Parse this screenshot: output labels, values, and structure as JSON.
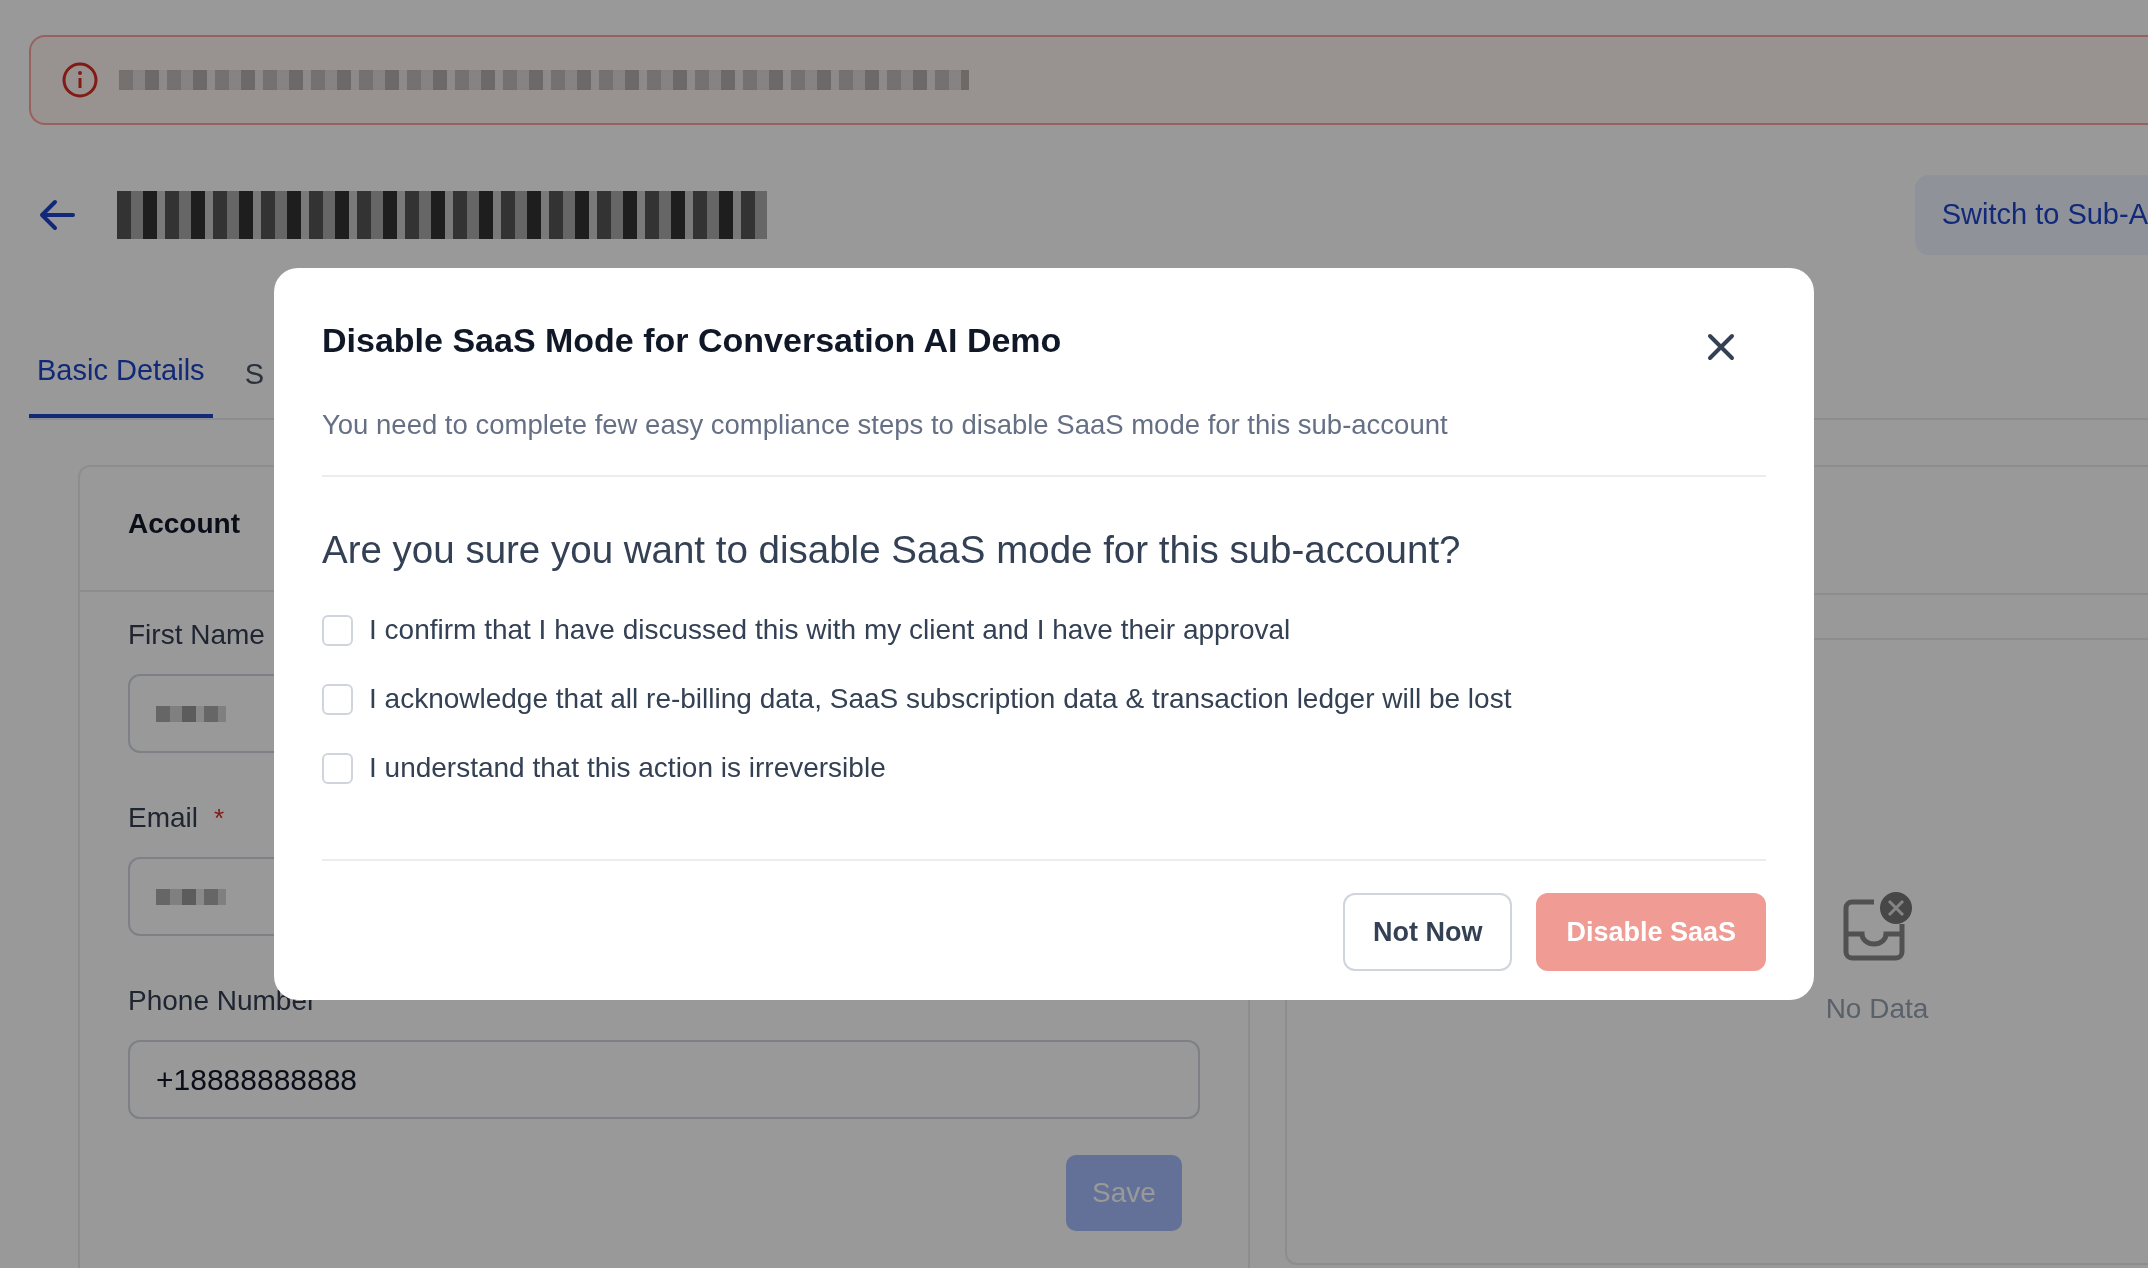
{
  "page": {
    "tabs": [
      {
        "label": "Basic Details",
        "selected": true
      },
      {
        "label": "S",
        "selected": false
      }
    ],
    "switch_button": "Switch to Sub-A"
  },
  "account_card": {
    "title": "Account",
    "fields": [
      {
        "label": "First Name"
      },
      {
        "label": "Email",
        "required_mark": "*"
      },
      {
        "label": "Phone Number",
        "value": "+18888888888"
      }
    ],
    "save_button": "Save"
  },
  "side_panel": {
    "empty_text": "No Data"
  },
  "modal": {
    "title": "Disable SaaS Mode for Conversation AI Demo",
    "subtitle": "You need to complete few easy compliance steps to disable SaaS mode for this sub-account",
    "question": "Are you sure you want to disable SaaS mode for this sub-account?",
    "confirmations": [
      {
        "label": "I confirm that I have discussed this with my client and I have their approval",
        "checked": false
      },
      {
        "label": "I acknowledge that all re-billing data, SaaS subscription data & transaction ledger will be lost",
        "checked": false
      },
      {
        "label": "I understand that this action is irreversible",
        "checked": false
      }
    ],
    "buttons": [
      {
        "label": "Not Now",
        "kind": "secondary",
        "disabled": false
      },
      {
        "label": "Disable SaaS",
        "kind": "danger",
        "disabled": true
      }
    ]
  }
}
